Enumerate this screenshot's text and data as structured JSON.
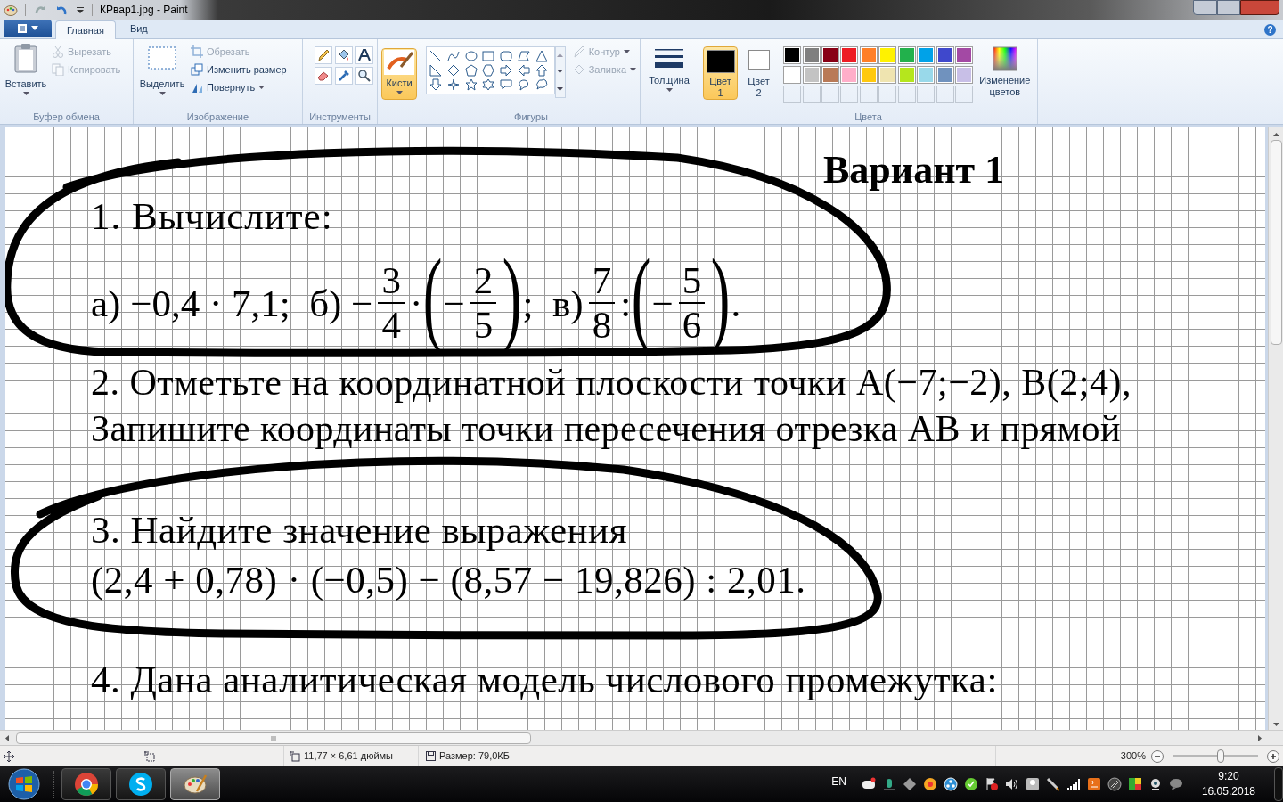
{
  "title_bar": {
    "title": "КРвар1.jpg - Paint"
  },
  "tabs": [
    {
      "label": "Главная",
      "selected": true
    },
    {
      "label": "Вид",
      "selected": false
    }
  ],
  "help": "?",
  "ribbon": {
    "clipboard": {
      "label": "Буфер обмена",
      "paste": "Вставить",
      "cut": {
        "label": "Вырезать",
        "disabled": true
      },
      "copy": {
        "label": "Копировать",
        "disabled": true
      }
    },
    "image": {
      "label": "Изображение",
      "select": "Выделить",
      "crop": {
        "label": "Обрезать",
        "disabled": true
      },
      "resize": {
        "label": "Изменить размер",
        "disabled": false
      },
      "rotate": {
        "label": "Повернуть",
        "disabled": false
      }
    },
    "tools": {
      "label": "Инструменты"
    },
    "brushes": {
      "label": "Кисти",
      "selected": true
    },
    "shapes": {
      "label": "Фигуры",
      "outline": {
        "label": "Контур",
        "disabled": true
      },
      "fill": {
        "label": "Заливка",
        "disabled": true
      }
    },
    "size": {
      "label": "Толщина"
    },
    "color_slots": [
      {
        "label": "Цвет",
        "number": "1",
        "color": "#000000",
        "selected": true
      },
      {
        "label": "Цвет",
        "number": "2",
        "color": "#ffffff",
        "selected": false
      }
    ],
    "palette": {
      "label": "Цвета",
      "colors": [
        {
          "color": "#000000"
        },
        {
          "color": "#7f7f7f"
        },
        {
          "color": "#880015"
        },
        {
          "color": "#ed1c24"
        },
        {
          "color": "#ff7f27"
        },
        {
          "color": "#fff200"
        },
        {
          "color": "#22b14c"
        },
        {
          "color": "#00a2e8"
        },
        {
          "color": "#3f48cc"
        },
        {
          "color": "#a349a4"
        },
        {
          "color": "#ffffff"
        },
        {
          "color": "#c3c3c3"
        },
        {
          "color": "#b97a57"
        },
        {
          "color": "#ffaec9"
        },
        {
          "color": "#ffc90e"
        },
        {
          "color": "#efe4b0"
        },
        {
          "color": "#b5e61d"
        },
        {
          "color": "#99d9ea"
        },
        {
          "color": "#7092be"
        },
        {
          "color": "#c8bfe7"
        }
      ]
    },
    "edit_colors": "Изменение цветов"
  },
  "worksheet": {
    "title": "Вариант 1",
    "task1": {
      "heading": "1. Вычислите:",
      "expression": [
        {
          "kind": "text",
          "text": "а) −0,4 · 7,1;  б) −"
        },
        {
          "kind": "fraction",
          "numerator": "3",
          "denominator": "4"
        },
        {
          "kind": "text",
          "text": "·"
        },
        {
          "kind": "paren",
          "text": "("
        },
        {
          "kind": "text",
          "text": "−"
        },
        {
          "kind": "fraction",
          "numerator": "2",
          "denominator": "5"
        },
        {
          "kind": "paren",
          "text": ")"
        },
        {
          "kind": "text",
          "text": ";  в)"
        },
        {
          "kind": "fraction",
          "numerator": "7",
          "denominator": "8"
        },
        {
          "kind": "text",
          "text": ":"
        },
        {
          "kind": "paren",
          "text": "("
        },
        {
          "kind": "text",
          "text": "−"
        },
        {
          "kind": "fraction",
          "numerator": "5",
          "denominator": "6"
        },
        {
          "kind": "paren",
          "text": ")"
        },
        {
          "kind": "text",
          "text": "."
        }
      ]
    },
    "task2": [
      "2. Отметьте на координатной плоскости точки A(−7;−2), B(2;4),",
      "Запишите координаты точки пересечения отрезка AB и прямой"
    ],
    "task3": [
      "3. Найдите значение выражения",
      "(2,4 + 0,78) · (−0,5) − (8,57 − 19,826) : 2,01."
    ],
    "task4": "4. Дана аналитическая модель числового промежутка:"
  },
  "status_bar": {
    "dimensions": "11,77 × 6,61 дюймы",
    "file_size": "Размер: 79,0КБ",
    "zoom": "300%",
    "zoom_slider": {
      "level": 0.56
    }
  },
  "taskbar": {
    "apps": [
      {
        "kind": "chrome",
        "selected": false
      },
      {
        "kind": "skype",
        "selected": false
      },
      {
        "kind": "paint",
        "selected": true
      }
    ],
    "language": "EN",
    "time": "9:20",
    "date": "16.05.2018"
  }
}
